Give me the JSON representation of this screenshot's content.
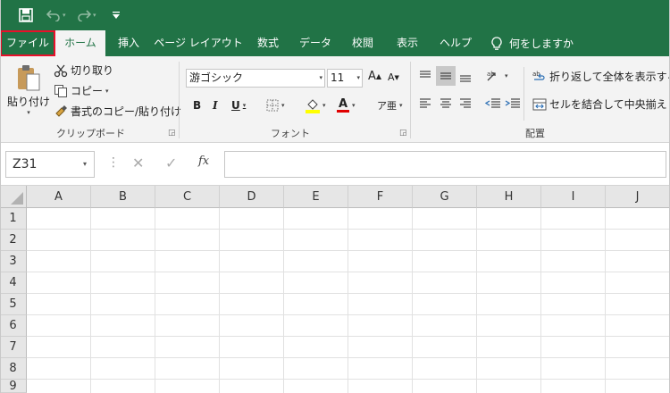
{
  "qat": {
    "redo_more": "▾",
    "customize": "▾"
  },
  "tabs": {
    "file": "ファイル",
    "home": "ホーム",
    "insert": "挿入",
    "page_layout": "ページ レイアウト",
    "formulas": "数式",
    "data": "データ",
    "review": "校閲",
    "view": "表示",
    "help": "ヘルプ",
    "tell_me": "何をしますか"
  },
  "clipboard": {
    "paste": "貼り付け",
    "cut": "切り取り",
    "copy": "コピー",
    "format_painter": "書式のコピー/貼り付け",
    "label": "クリップボード"
  },
  "font": {
    "name": "游ゴシック",
    "size": "11",
    "grow": "A",
    "shrink": "A",
    "bold": "B",
    "italic": "I",
    "underline": "U",
    "font_color_letter": "A",
    "label": "フォント"
  },
  "alignment": {
    "wrap_text": "折り返して全体を表示する",
    "merge_center": "セルを結合して中央揃え",
    "label": "配置"
  },
  "formula_bar": {
    "name_box": "Z31",
    "dots": "⋮",
    "cancel": "✕",
    "enter": "✓",
    "fx": "fx",
    "value": ""
  },
  "columns": [
    "A",
    "B",
    "C",
    "D",
    "E",
    "F",
    "G",
    "H",
    "I",
    "J"
  ],
  "rows": [
    "1",
    "2",
    "3",
    "4",
    "5",
    "6",
    "7",
    "8",
    "9"
  ],
  "colors": {
    "accent": "#217346",
    "highlight_box": "#e8102a",
    "font_color_bar": "#e00000",
    "fill_color_bar": "#ffff00"
  }
}
